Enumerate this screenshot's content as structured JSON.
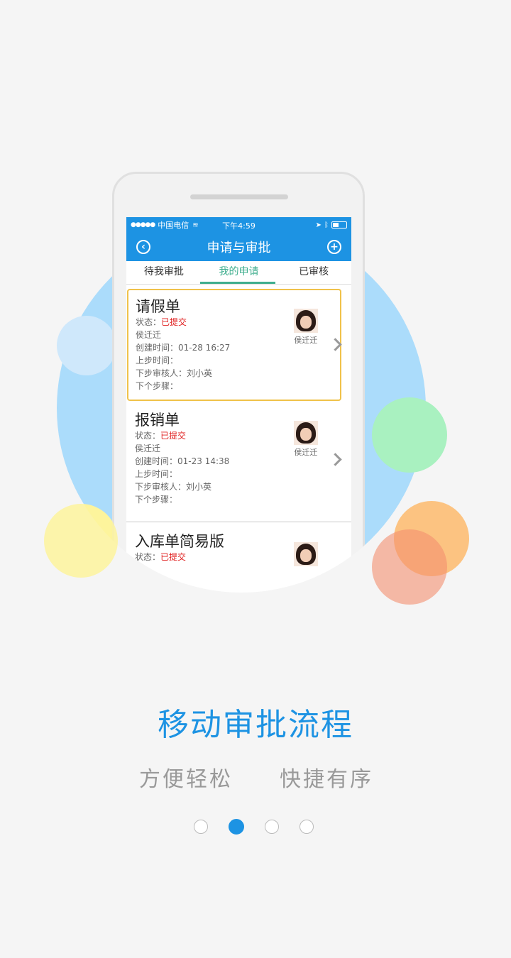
{
  "colors": {
    "accent": "#1d93e3",
    "tab_active": "#3fae8e",
    "status_red": "#e02020"
  },
  "statusbar": {
    "carrier": "中国电信",
    "time": "下午4:59"
  },
  "navbar": {
    "title": "申请与审批",
    "back_icon": "back-icon",
    "add_icon": "add-icon"
  },
  "tabs": [
    {
      "label": "待我审批"
    },
    {
      "label": "我的申请"
    },
    {
      "label": "已审核"
    }
  ],
  "items": [
    {
      "title": "请假单",
      "status_label": "状态：",
      "status": "已提交",
      "applicant": "侯迁迁",
      "created": "创建时间：01-28 16:27",
      "prev_step": "上步时间：",
      "next_reviewer": "下步审核人：刘小英",
      "next_step": "下个步骤：",
      "avatar_name": "侯迁迁"
    },
    {
      "title": "报销单",
      "status_label": "状态：",
      "status": "已提交",
      "applicant": "侯迁迁",
      "created": "创建时间：01-23 14:38",
      "prev_step": "上步时间：",
      "next_reviewer": "下步审核人：刘小英",
      "next_step": "下个步骤：",
      "avatar_name": "侯迁迁"
    },
    {
      "title": "入库单简易版",
      "status_label": "状态：",
      "status": "已提交"
    }
  ],
  "headline": "移动审批流程",
  "subline": [
    "方便轻松",
    "快捷有序"
  ],
  "pager": {
    "count": 4,
    "active_index": 1
  }
}
